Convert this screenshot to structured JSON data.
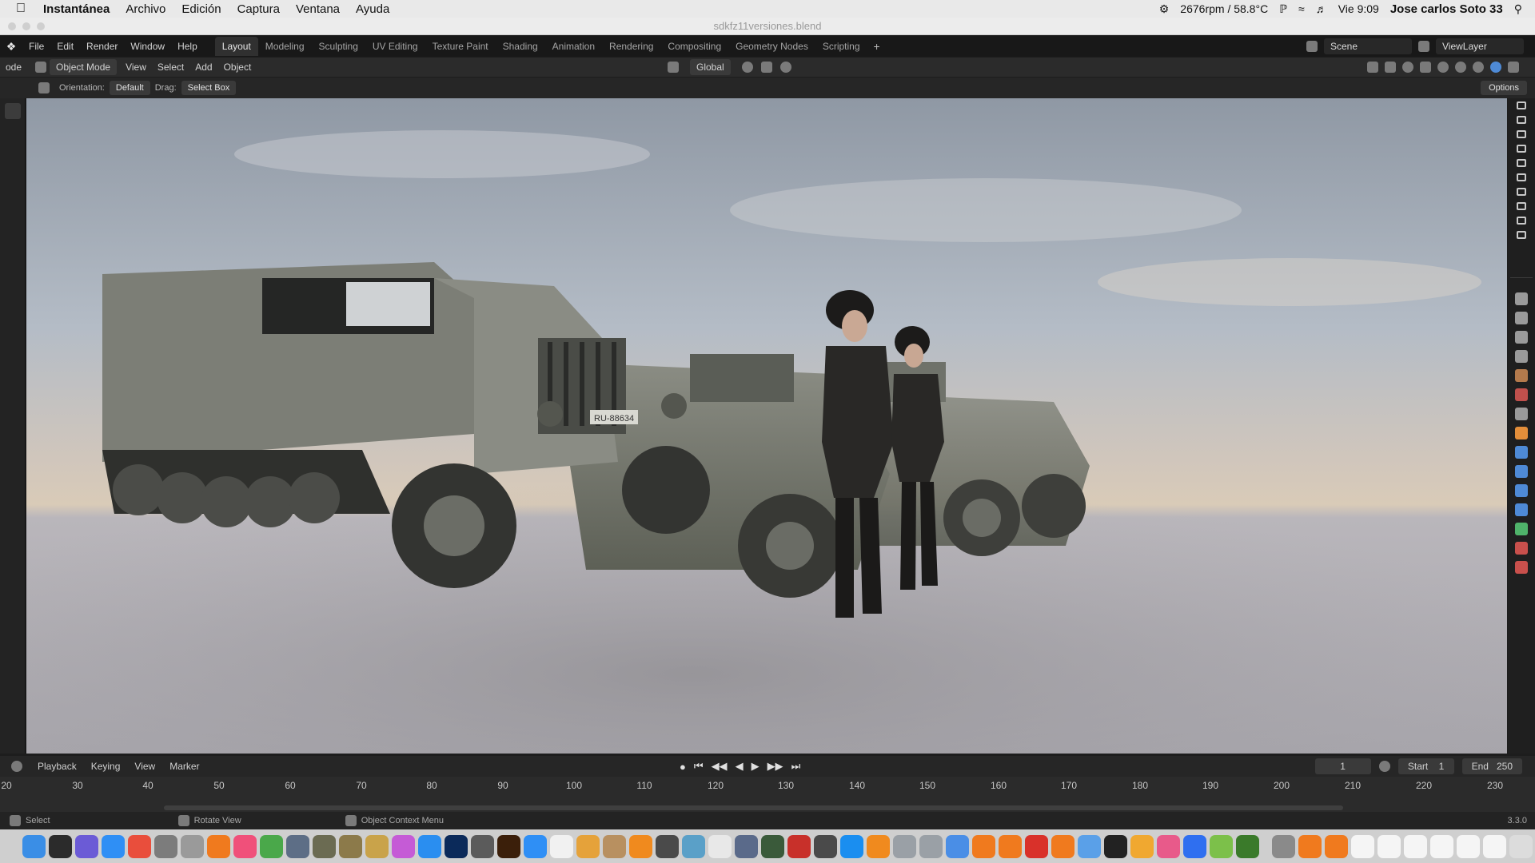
{
  "mac_menubar": {
    "app_name": "Instantánea",
    "menus": [
      "Archivo",
      "Edición",
      "Captura",
      "Ventana",
      "Ayuda"
    ],
    "status": {
      "fan": "2676rpm / 58.8°C",
      "clock": "Vie 9:09",
      "user": "Jose carlos Soto 33"
    }
  },
  "window": {
    "title": "sdkfz11versiones.blend"
  },
  "blender_topbar": {
    "menus": [
      "File",
      "Edit",
      "Render",
      "Window",
      "Help"
    ],
    "workspaces": [
      "Layout",
      "Modeling",
      "Sculpting",
      "UV Editing",
      "Texture Paint",
      "Shading",
      "Animation",
      "Rendering",
      "Compositing",
      "Geometry Nodes",
      "Scripting"
    ],
    "active_workspace": "Layout",
    "scene_name": "Scene",
    "view_layer": "ViewLayer"
  },
  "viewport_header": {
    "editor_prefix": "ode",
    "mode": "Object Mode",
    "menus": [
      "View",
      "Select",
      "Add",
      "Object"
    ],
    "transform_orientation": "Global"
  },
  "tool_settings": {
    "orientation_label": "Orientation:",
    "orientation_value": "Default",
    "drag_label": "Drag:",
    "drag_value": "Select Box",
    "options_label": "Options"
  },
  "timeline": {
    "menus": [
      "Playback",
      "Keying",
      "View",
      "Marker"
    ],
    "current_frame": "1",
    "start_label": "Start",
    "start_value": "1",
    "end_label": "End",
    "end_value": "250",
    "ruler_ticks": [
      "20",
      "30",
      "40",
      "50",
      "60",
      "70",
      "80",
      "90",
      "100",
      "110",
      "120",
      "130",
      "140",
      "150",
      "160",
      "170",
      "180",
      "190",
      "200",
      "210",
      "220",
      "230"
    ]
  },
  "statusbar": {
    "items": [
      "Select",
      "Rotate View",
      "Object Context Menu"
    ],
    "version": "3.3.0"
  },
  "scene": {
    "vehicle_plate": "RU-88634"
  },
  "colors": {
    "ui_dark": "#1d1d1d",
    "active_tab": "#303030",
    "accent_blue": "#4e8ad6"
  }
}
